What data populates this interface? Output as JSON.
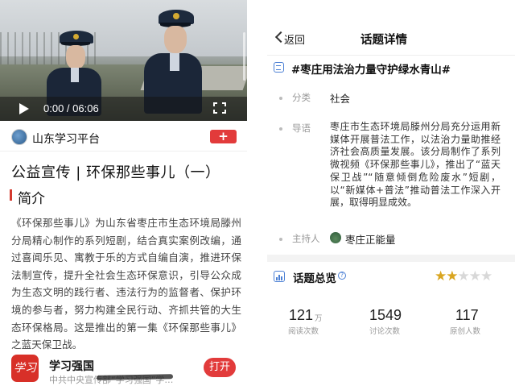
{
  "left": {
    "video": {
      "time": "0:00 / 06:06",
      "progress": 0
    },
    "publisher": {
      "name": "山东学习平台",
      "add_label": "+"
    },
    "title": "公益宣传 | 环保那些事儿（一）",
    "section_title": "简介",
    "description": "《环保那些事儿》为山东省枣庄市生态环境局滕州分局精心制作的系列短剧，结合真实案例改编，通过喜闻乐见、寓教于乐的方式自编自演，推进环保法制宣传，提升全社会生态环保意识，引导公众成为生态文明的践行者、违法行为的监督者、保护环境的参与者，努力构建全民行动、齐抓共管的大生态环保格局。这是推出的第一集《环保那些事儿》之蓝天保卫战。",
    "app": {
      "logo": "学习",
      "name": "学习强国",
      "subtitle": "中共中央宣传部“学习强国”学…",
      "open_label": "打开"
    }
  },
  "right": {
    "nav": {
      "back_label": "返回",
      "title": "话题详情"
    },
    "topic_title": "#枣庄用法治力量守护绿水青山#",
    "category_label": "分类",
    "category_value": "社会",
    "intro_label": "导语",
    "intro_value": "枣庄市生态环境局滕州分局充分运用新媒体开展普法工作，以法治力量助推经济社会高质量发展。该分局制作了系列微视频《环保那些事儿》，推出了“蓝天保卫战”“随意倾倒危险废水”短剧，以“新媒体+普法”推动普法工作深入开展，取得明显成效。",
    "host_label": "主持人",
    "host_value": "枣庄正能量",
    "overview_title": "话题总览",
    "rating": 2,
    "rating_max": 5,
    "stats": {
      "reads": "121",
      "reads_unit": "万",
      "reads_label": "阅读次数",
      "discussions": "1549",
      "discussions_label": "讨论次数",
      "originals": "117",
      "originals_label": "原创人数"
    }
  },
  "colors": {
    "accent_red": "#e23b3b",
    "accent_blue": "#4a7fd4",
    "star_gold": "#d9a520",
    "star_gray": "#d8d8d8"
  }
}
